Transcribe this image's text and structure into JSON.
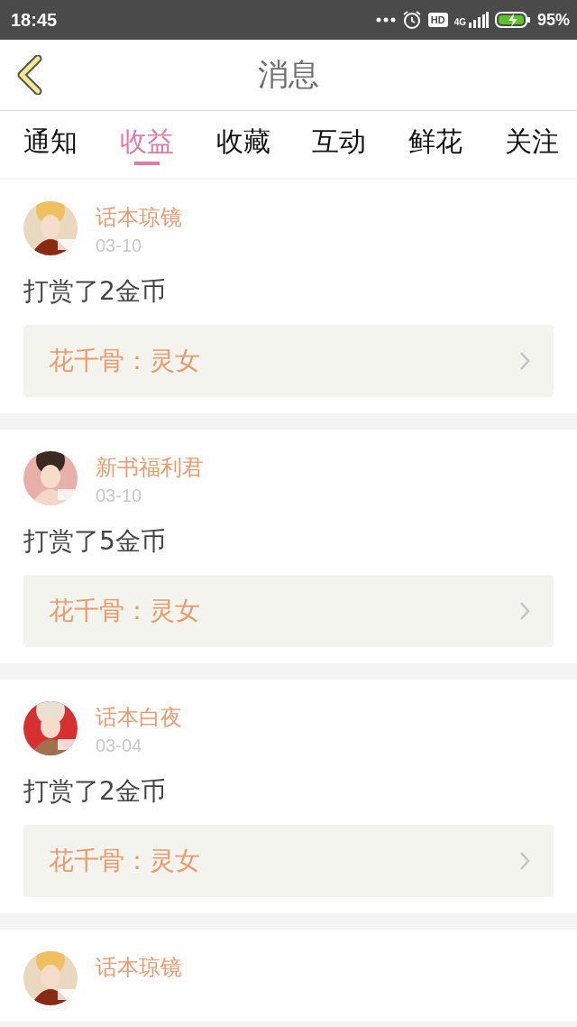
{
  "status_bar": {
    "time": "18:45",
    "hd": "HD",
    "network": "4G",
    "battery": "95%"
  },
  "header": {
    "title": "消息"
  },
  "tabs": [
    {
      "label": "通知",
      "selected": false
    },
    {
      "label": "收益",
      "selected": true
    },
    {
      "label": "收藏",
      "selected": false
    },
    {
      "label": "互动",
      "selected": false
    },
    {
      "label": "鲜花",
      "selected": false
    },
    {
      "label": "关注",
      "selected": false
    }
  ],
  "messages": [
    {
      "user": "话本琼镜",
      "date": "03-10",
      "text": "打赏了2金币",
      "book": "花千骨：灵女"
    },
    {
      "user": "新书福利君",
      "date": "03-10",
      "text": "打赏了5金币",
      "book": "花千骨：灵女"
    },
    {
      "user": "话本白夜",
      "date": "03-04",
      "text": "打赏了2金币",
      "book": "花千骨：灵女"
    },
    {
      "user": "话本琼镜"
    }
  ]
}
